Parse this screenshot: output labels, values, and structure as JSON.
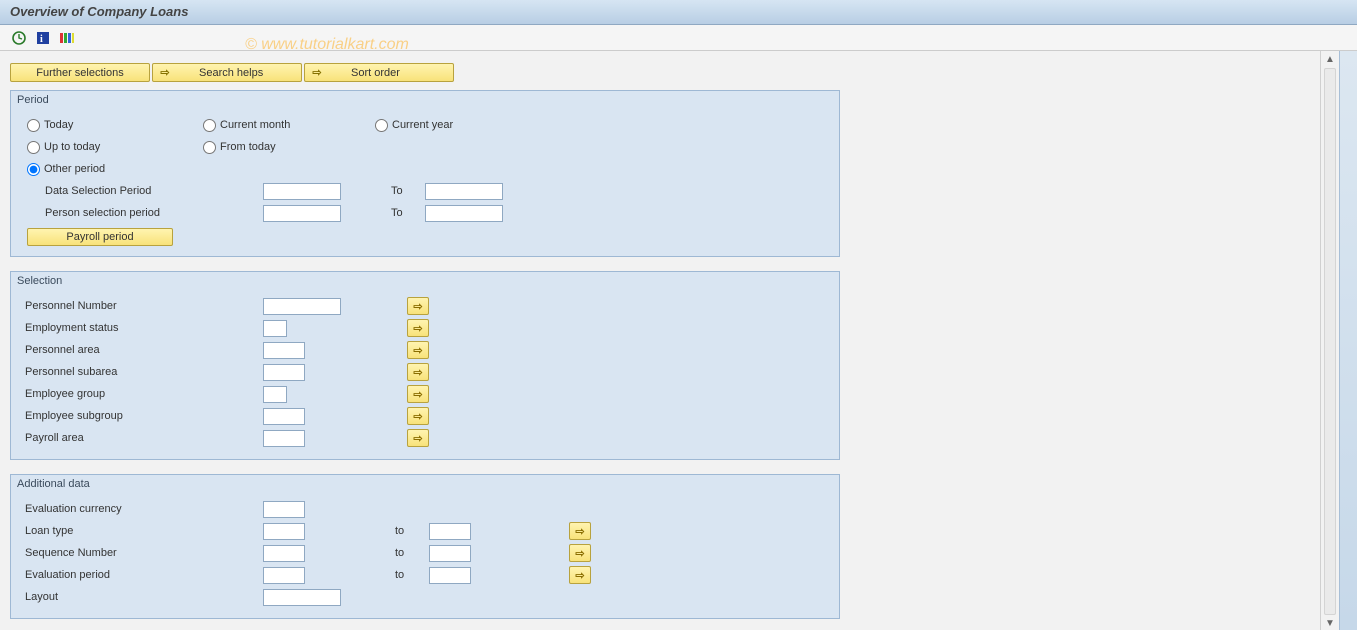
{
  "title": "Overview of Company Loans",
  "watermark": "© www.tutorialkart.com",
  "topButtons": {
    "further": "Further selections",
    "search": "Search helps",
    "sort": "Sort order"
  },
  "period": {
    "title": "Period",
    "radios": {
      "today": "Today",
      "currentMonth": "Current month",
      "currentYear": "Current year",
      "upToToday": "Up to today",
      "fromToday": "From today",
      "other": "Other period"
    },
    "dataSelLabel": "Data Selection Period",
    "personSelLabel": "Person selection period",
    "toLabel": "To",
    "payrollBtn": "Payroll period",
    "dataFrom": "",
    "dataTo": "",
    "personFrom": "",
    "personTo": ""
  },
  "selection": {
    "title": "Selection",
    "rows": [
      {
        "label": "Personnel Number",
        "w": "w70",
        "val": ""
      },
      {
        "label": "Employment status",
        "w": "w28",
        "val": ""
      },
      {
        "label": "Personnel area",
        "w": "w40",
        "val": ""
      },
      {
        "label": "Personnel subarea",
        "w": "w40",
        "val": ""
      },
      {
        "label": "Employee group",
        "w": "w28",
        "val": ""
      },
      {
        "label": "Employee subgroup",
        "w": "w40",
        "val": ""
      },
      {
        "label": "Payroll area",
        "w": "w40",
        "val": ""
      }
    ]
  },
  "additional": {
    "title": "Additional data",
    "evalCurrLabel": "Evaluation currency",
    "evalCurrVal": "",
    "toLabel": "to",
    "rows": [
      {
        "label": "Loan type",
        "from": "",
        "to": ""
      },
      {
        "label": "Sequence Number",
        "from": "",
        "to": ""
      },
      {
        "label": "Evaluation period",
        "from": "",
        "to": ""
      }
    ],
    "layoutLabel": "Layout",
    "layoutVal": ""
  }
}
